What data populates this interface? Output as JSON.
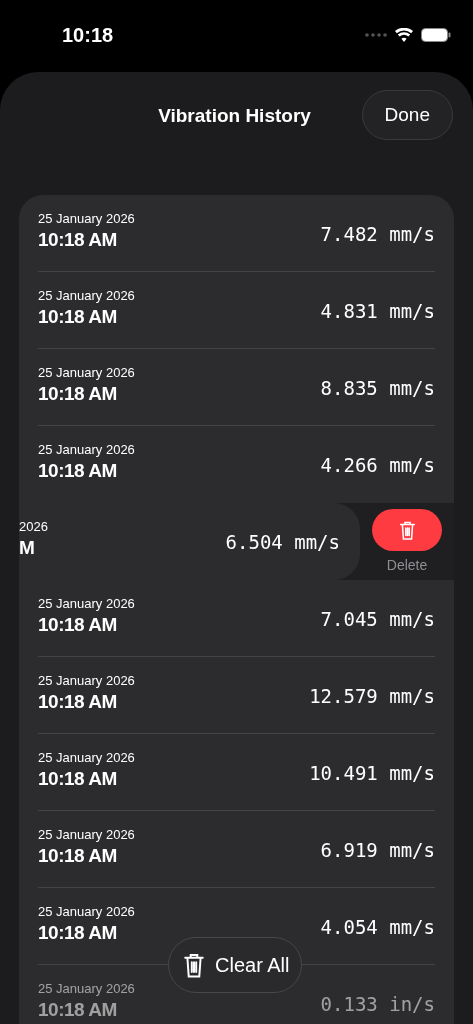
{
  "status_bar": {
    "time": "10:18"
  },
  "header": {
    "title": "Vibration History",
    "done_button": "Done"
  },
  "entries": [
    {
      "kind": "normal",
      "date": "25 January 2026",
      "time": "10:18 AM",
      "value": "7.482 mm/s",
      "dimmed": false
    },
    {
      "kind": "normal",
      "date": "25 January 2026",
      "time": "10:18 AM",
      "value": "4.831 mm/s",
      "dimmed": false
    },
    {
      "kind": "normal",
      "date": "25 January 2026",
      "time": "10:18 AM",
      "value": "8.835 mm/s",
      "dimmed": false
    },
    {
      "kind": "normal",
      "date": "25 January 2026",
      "time": "10:18 AM",
      "value": "4.266 mm/s",
      "dimmed": false
    },
    {
      "kind": "swiped",
      "date": "2026",
      "time": "M",
      "value": "6.504 mm/s",
      "dimmed": false,
      "action": "Delete"
    },
    {
      "kind": "normal",
      "date": "25 January 2026",
      "time": "10:18 AM",
      "value": "7.045 mm/s",
      "dimmed": false
    },
    {
      "kind": "normal",
      "date": "25 January 2026",
      "time": "10:18 AM",
      "value": "12.579 mm/s",
      "dimmed": false
    },
    {
      "kind": "normal",
      "date": "25 January 2026",
      "time": "10:18 AM",
      "value": "10.491 mm/s",
      "dimmed": false
    },
    {
      "kind": "normal",
      "date": "25 January 2026",
      "time": "10:18 AM",
      "value": "6.919 mm/s",
      "dimmed": false
    },
    {
      "kind": "normal",
      "date": "25 January 2026",
      "time": "10:18 AM",
      "value": "4.054 mm/s",
      "dimmed": false
    },
    {
      "kind": "normal",
      "date": "25 January 2026",
      "time": "10:18 AM",
      "value": "0.133 in/s",
      "dimmed": true
    }
  ],
  "clear_all_button": "Clear All"
}
